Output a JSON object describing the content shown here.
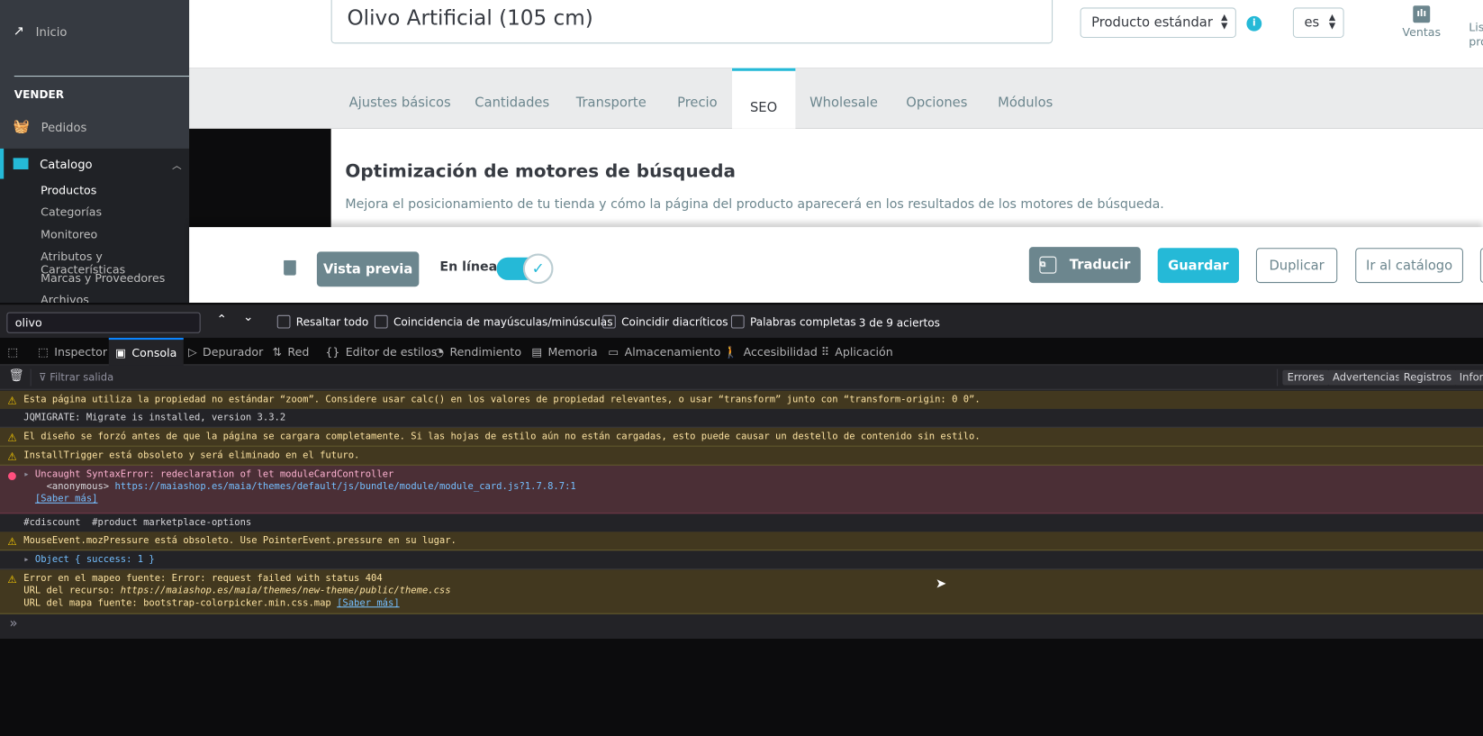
{
  "sidebar": {
    "home": "Inicio",
    "section": "VENDER",
    "orders": "Pedidos",
    "catalog": "Catalogo",
    "sub": [
      "Productos",
      "Categorías",
      "Monitoreo",
      "Atributos y Características",
      "Marcas y Proveedores",
      "Archivos"
    ],
    "accent": "#25b9d7"
  },
  "header": {
    "product_name": "Olivo Artificial (105 cm)",
    "product_type": "Producto estándar",
    "language": "es",
    "sales_label": "Ventas",
    "list_label_partial": [
      "Lis",
      "pro"
    ]
  },
  "tabs": [
    "Ajustes básicos",
    "Cantidades",
    "Transporte",
    "Precio",
    "SEO",
    "Wholesale",
    "Opciones",
    "Módulos"
  ],
  "active_tab": "SEO",
  "seo": {
    "title": "Optimización de motores de búsqueda",
    "description": "Mejora el posicionamiento de tu tienda y cómo la página del producto aparecerá en los resultados de los motores de búsqueda."
  },
  "footer": {
    "preview": "Vista previa",
    "online_label": "En línea",
    "online": true,
    "translate": "Traducir",
    "save": "Guardar",
    "duplicate": "Duplicar",
    "go_catalog": "Ir al catálogo"
  },
  "devtools": {
    "find": {
      "query": "olivo",
      "options": [
        "Resaltar todo",
        "Coincidencia de mayúsculas/minúsculas",
        "Coincidir diacríticos",
        "Palabras completas"
      ],
      "result": "3 de 9 aciertos"
    },
    "tabs": [
      "Inspector",
      "Consola",
      "Depurador",
      "Red",
      "Editor de estilos",
      "Rendimiento",
      "Memoria",
      "Almacenamiento",
      "Accesibilidad",
      "Aplicación"
    ],
    "active_tab": "Consola",
    "filter_placeholder": "Filtrar salida",
    "filters": [
      "Errores",
      "Advertencias",
      "Registros",
      "Infor"
    ],
    "messages": [
      {
        "type": "warn",
        "text": "Esta página utiliza la propiedad no estándar “zoom”. Considere usar calc() en los valores de propiedad relevantes, o usar “transform” junto con “transform-origin: 0 0”."
      },
      {
        "type": "log",
        "text": "JQMIGRATE: Migrate is installed, version 3.3.2"
      },
      {
        "type": "warn",
        "text": "El diseño se forzó antes de que la página se cargara completamente. Si las hojas de estilo aún no están cargadas, esto puede causar un destello de contenido sin estilo."
      },
      {
        "type": "warn",
        "text": "InstallTrigger está obsoleto y será eliminado en el futuro."
      },
      {
        "type": "err",
        "text": "Uncaught SyntaxError: redeclaration of let moduleCardController",
        "frame": "<anonymous>",
        "url": "https://maiashop.es/maia/themes/default/js/bundle/module/module_card.js?1.7.8.7:1",
        "learn": "[Saber más]"
      },
      {
        "type": "log",
        "text": "#cdiscount  #product marketplace-options"
      },
      {
        "type": "warn",
        "text": "MouseEvent.mozPressure está obsoleto. Use PointerEvent.pressure en su lugar."
      },
      {
        "type": "log",
        "text": "Object { success: 1 }"
      },
      {
        "type": "warn",
        "text": "Error en el mapeo fuente: Error: request failed with status 404",
        "line2_label": "URL del recurso: ",
        "line2_url": "https://maiashop.es/maia/themes/new-theme/public/theme.css",
        "line3_label": "URL del mapa fuente: bootstrap-colorpicker.min.css.map ",
        "learn": "[Saber más]"
      }
    ],
    "prompt": "»"
  }
}
